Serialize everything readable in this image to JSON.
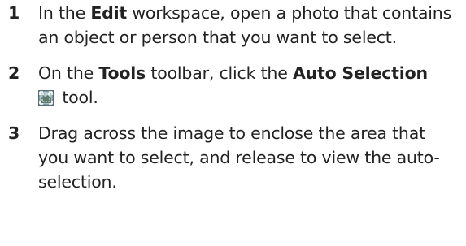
{
  "steps": [
    {
      "number": "1",
      "pre": "In the ",
      "bold1": "Edit",
      "post": " workspace, open a photo that contains an object or person that you want to select."
    },
    {
      "number": "2",
      "pre": "On the ",
      "bold1": "Tools",
      "mid": " toolbar, click the ",
      "bold2": "Auto Selection",
      "icon": "auto-selection-icon",
      "post": " tool."
    },
    {
      "number": "3",
      "text": "Drag across the image to enclose the area that you want to select, and release to view the auto-selection."
    }
  ]
}
